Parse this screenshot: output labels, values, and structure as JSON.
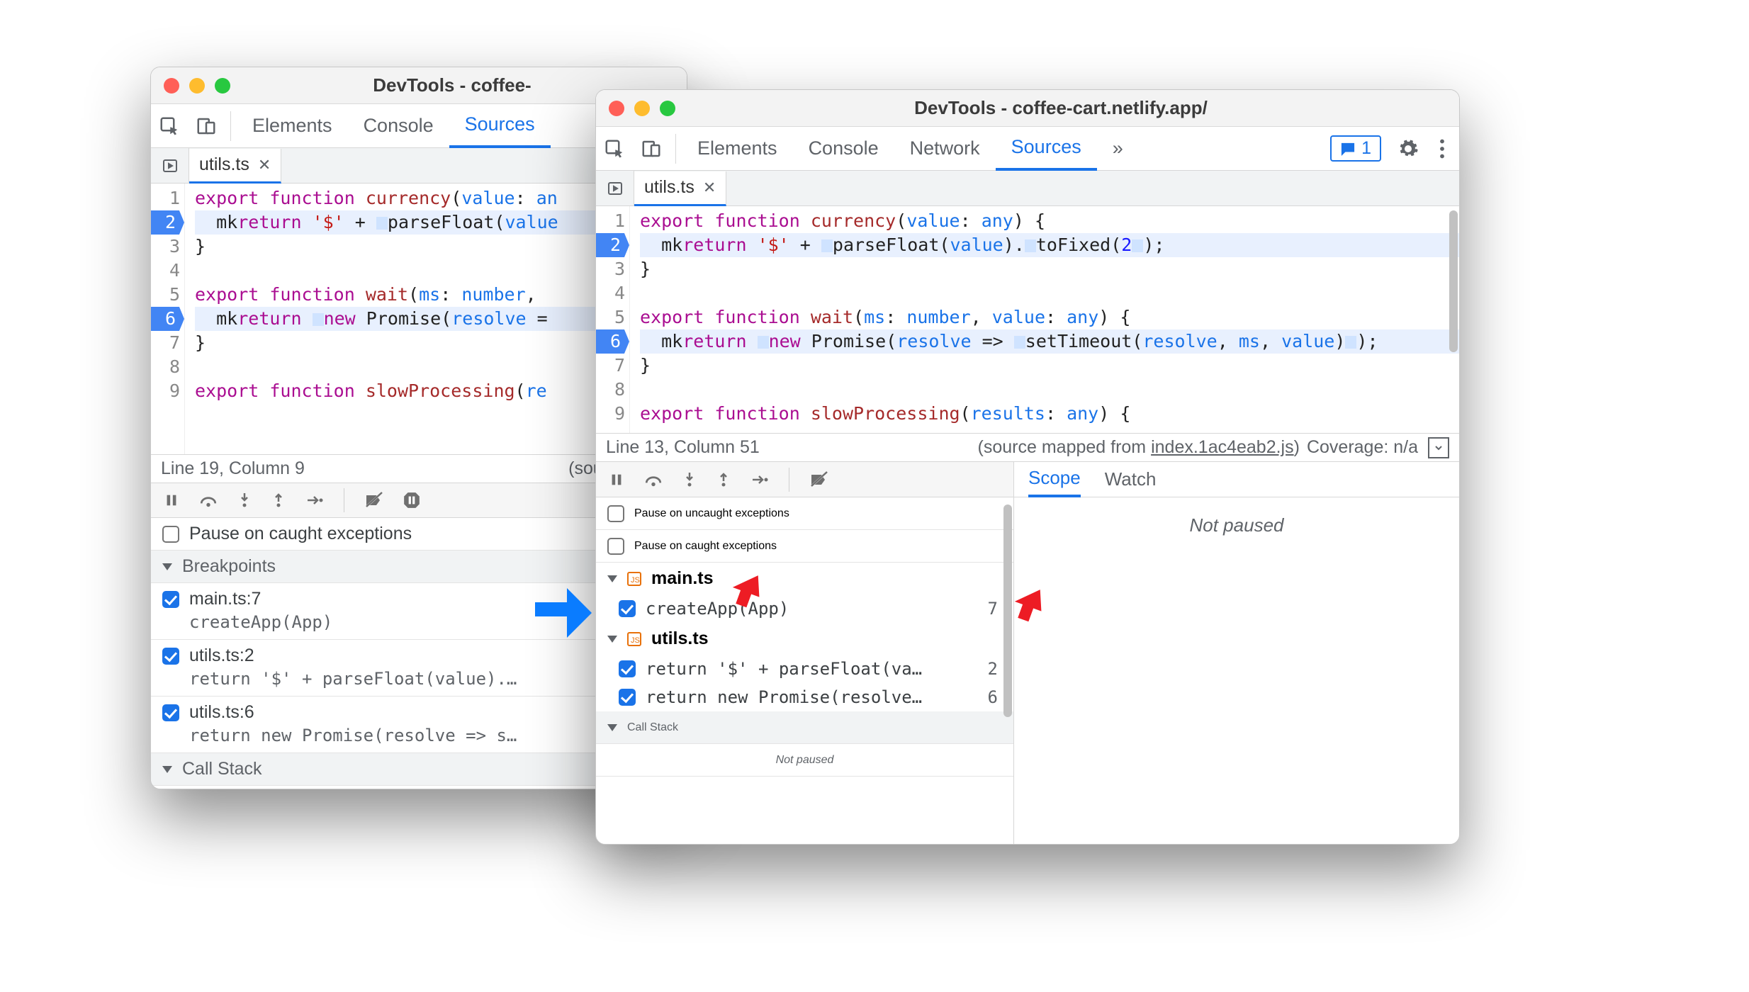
{
  "window1": {
    "title": "DevTools - coffee-",
    "tabs": [
      "Elements",
      "Console",
      "Sources"
    ],
    "activeTab": "Sources",
    "filetab": "utils.ts",
    "code": {
      "lines": [
        {
          "n": 1,
          "bp": false,
          "html": "kw:export |kw:function |fn:currency|id:(|ty:value|id:: |ty:an"
        },
        {
          "n": 2,
          "bp": true,
          "html": "  mk|kw:return |str:'$'|id: + |mk2|id:parseFloat(|ty:value"
        },
        {
          "n": 3,
          "bp": false,
          "html": "id:}"
        },
        {
          "n": 4,
          "bp": false,
          "html": ""
        },
        {
          "n": 5,
          "bp": false,
          "html": "kw:export |kw:function |fn:wait|id:(|ty:ms|id:: |ty:number|id:, "
        },
        {
          "n": 6,
          "bp": true,
          "html": "  mk|kw:return |mk2|kw:new |id:Promise(|ty:resolve|id: ="
        },
        {
          "n": 7,
          "bp": false,
          "html": "id:}"
        },
        {
          "n": 8,
          "bp": false,
          "html": ""
        },
        {
          "n": 9,
          "bp": false,
          "html": "kw:export |kw:function |fn:slowProcessing|id:(|ty:re"
        }
      ]
    },
    "statusLeft": "Line 19, Column 9",
    "statusRight": "(source mapp",
    "pauseCaught": "Pause on caught exceptions",
    "sectionBreakpoints": "Breakpoints",
    "breakpoints": [
      {
        "label": "main.ts:7",
        "snippet": "createApp(App)"
      },
      {
        "label": "utils.ts:2",
        "snippet": "return '$' + parseFloat(value).…"
      },
      {
        "label": "utils.ts:6",
        "snippet": "return new Promise(resolve => s…"
      }
    ],
    "sectionCallStack": "Call Stack"
  },
  "window2": {
    "title": "DevTools - coffee-cart.netlify.app/",
    "tabs": [
      "Elements",
      "Console",
      "Network",
      "Sources"
    ],
    "activeTab": "Sources",
    "more": "»",
    "issueCount": "1",
    "filetab": "utils.ts",
    "code": {
      "lines": [
        {
          "n": 1,
          "bp": false,
          "html": "kw:export |kw:function |fn:currency|id:(|ty:value|id:: |ty:any|id:) {"
        },
        {
          "n": 2,
          "bp": true,
          "html": "  mk|kw:return |str:'$'|id: + |mk2|id:parseFloat(|ty:value|id:).|mk2|id:toFixed(|num:2|mk2|id:);"
        },
        {
          "n": 3,
          "bp": false,
          "html": "id:}"
        },
        {
          "n": 4,
          "bp": false,
          "html": ""
        },
        {
          "n": 5,
          "bp": false,
          "html": "kw:export |kw:function |fn:wait|id:(|ty:ms|id:: |ty:number|id:, |ty:value|id:: |ty:any|id:) {"
        },
        {
          "n": 6,
          "bp": true,
          "html": "  mk|kw:return |mk2|kw:new |id:Promise(|ty:resolve|id: => |mk2|id:setTimeout(|ty:resolve|id:, |ty:ms|id:, |ty:value|id:)|mk2|id:);"
        },
        {
          "n": 7,
          "bp": false,
          "html": "id:}"
        },
        {
          "n": 8,
          "bp": false,
          "html": ""
        },
        {
          "n": 9,
          "bp": false,
          "html": "kw:export |kw:function |fn:slowProcessing|id:(|ty:results|id:: |ty:any|id:) {"
        }
      ]
    },
    "statusLeft": "Line 13, Column 51",
    "statusMappedPrefix": "(source mapped from ",
    "statusMappedFile": "index.1ac4eab2.js",
    "statusMappedSuffix": ")",
    "coverage": "Coverage: n/a",
    "pauseUn": "Pause on uncaught exceptions",
    "pauseCa": "Pause on caught exceptions",
    "groups": [
      {
        "file": "main.ts",
        "items": [
          {
            "snippet": "createApp(App)",
            "line": "7"
          }
        ]
      },
      {
        "file": "utils.ts",
        "items": [
          {
            "snippet": "return '$' + parseFloat(va…",
            "line": "2"
          },
          {
            "snippet": "return new Promise(resolve…",
            "line": "6"
          }
        ]
      }
    ],
    "sectionCallStack": "Call Stack",
    "notPaused": "Not paused",
    "scopeTab": "Scope",
    "watchTab": "Watch",
    "scopeBody": "Not paused"
  }
}
